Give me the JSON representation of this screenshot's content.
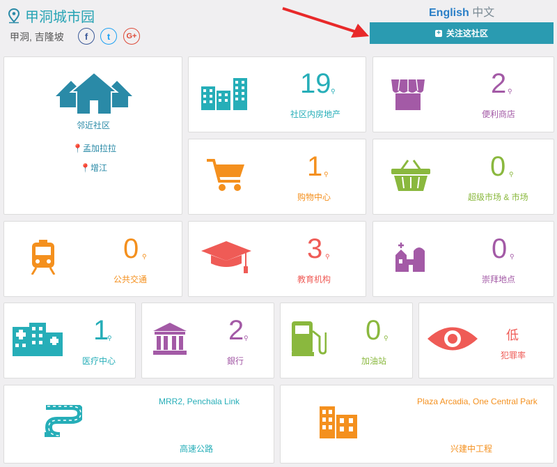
{
  "header": {
    "title": "甲洞城市园",
    "subtitle": "甲洞, 吉隆坡",
    "social": [
      "f",
      "t",
      "G+"
    ]
  },
  "lang": {
    "english": "English",
    "chinese": "中文"
  },
  "follow_button": "关注这社区",
  "neighbourhood": {
    "title": "邻近社区",
    "places": [
      "孟加拉拉",
      "增江"
    ]
  },
  "stats": {
    "properties": {
      "count": "19",
      "label": "社区内房地产"
    },
    "convenience": {
      "count": "2",
      "label": "便利商店"
    },
    "mall": {
      "count": "1",
      "label": "购物中心"
    },
    "supermarket": {
      "count": "0",
      "label": "超级市场 & 市场"
    },
    "transport": {
      "count": "0",
      "label": "公共交通"
    },
    "education": {
      "count": "3",
      "label": "教育机构"
    },
    "worship": {
      "count": "0",
      "label": "崇拜地点"
    },
    "medical": {
      "count": "1",
      "label": "医疗中心"
    },
    "bank": {
      "count": "2",
      "label": "銀行"
    },
    "petrol": {
      "count": "0",
      "label": "加油站"
    },
    "crime": {
      "value": "低",
      "label": "犯罪率"
    }
  },
  "highway": {
    "name": "MRR2, Penchala Link",
    "label": "高速公路"
  },
  "development": {
    "name": "Plaza Arcadia, One Central Park",
    "label": "兴建中工程"
  },
  "colors": {
    "teal": "#26aeb8",
    "purple": "#a35aa6",
    "orange": "#f4901e",
    "green": "#8ab83e",
    "red": "#ef5b56",
    "button": "#2a9bb1"
  },
  "icons": [
    "map-pin-icon",
    "facebook-icon",
    "twitter-icon",
    "google-plus-icon",
    "houses-icon",
    "buildings-icon",
    "shop-icon",
    "cart-icon",
    "basket-icon",
    "train-icon",
    "graduation-cap-icon",
    "church-icon",
    "hospital-icon",
    "bank-icon",
    "fuel-pump-icon",
    "eye-icon",
    "road-icon",
    "construction-building-icon",
    "red-arrow-icon"
  ]
}
